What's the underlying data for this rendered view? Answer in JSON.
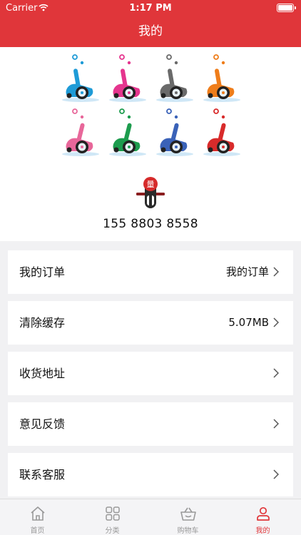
{
  "status_bar": {
    "carrier": "Carrier",
    "time": "1:17 PM"
  },
  "nav": {
    "title": "我的"
  },
  "profile": {
    "phone": "155 8803 8558",
    "logo_char": "量"
  },
  "menu": [
    {
      "label": "我的订单",
      "value": "我的订单"
    },
    {
      "label": "清除缓存",
      "value": "5.07MB"
    },
    {
      "label": "收货地址",
      "value": ""
    },
    {
      "label": "意见反馈",
      "value": ""
    },
    {
      "label": "联系客服",
      "value": ""
    }
  ],
  "tabs": [
    {
      "label": "首页",
      "icon": "home-icon",
      "active": false
    },
    {
      "label": "分类",
      "icon": "grid-icon",
      "active": false
    },
    {
      "label": "购物车",
      "icon": "basket-icon",
      "active": false
    },
    {
      "label": "我的",
      "icon": "person-icon",
      "active": true
    }
  ],
  "colors": {
    "brand": "#e0363a",
    "scooters": [
      "#1e9bd7",
      "#e5358e",
      "#6a6a6a",
      "#ef7d1a",
      "#e8679a",
      "#1d9c4e",
      "#3a62b8",
      "#d82b2b"
    ]
  }
}
